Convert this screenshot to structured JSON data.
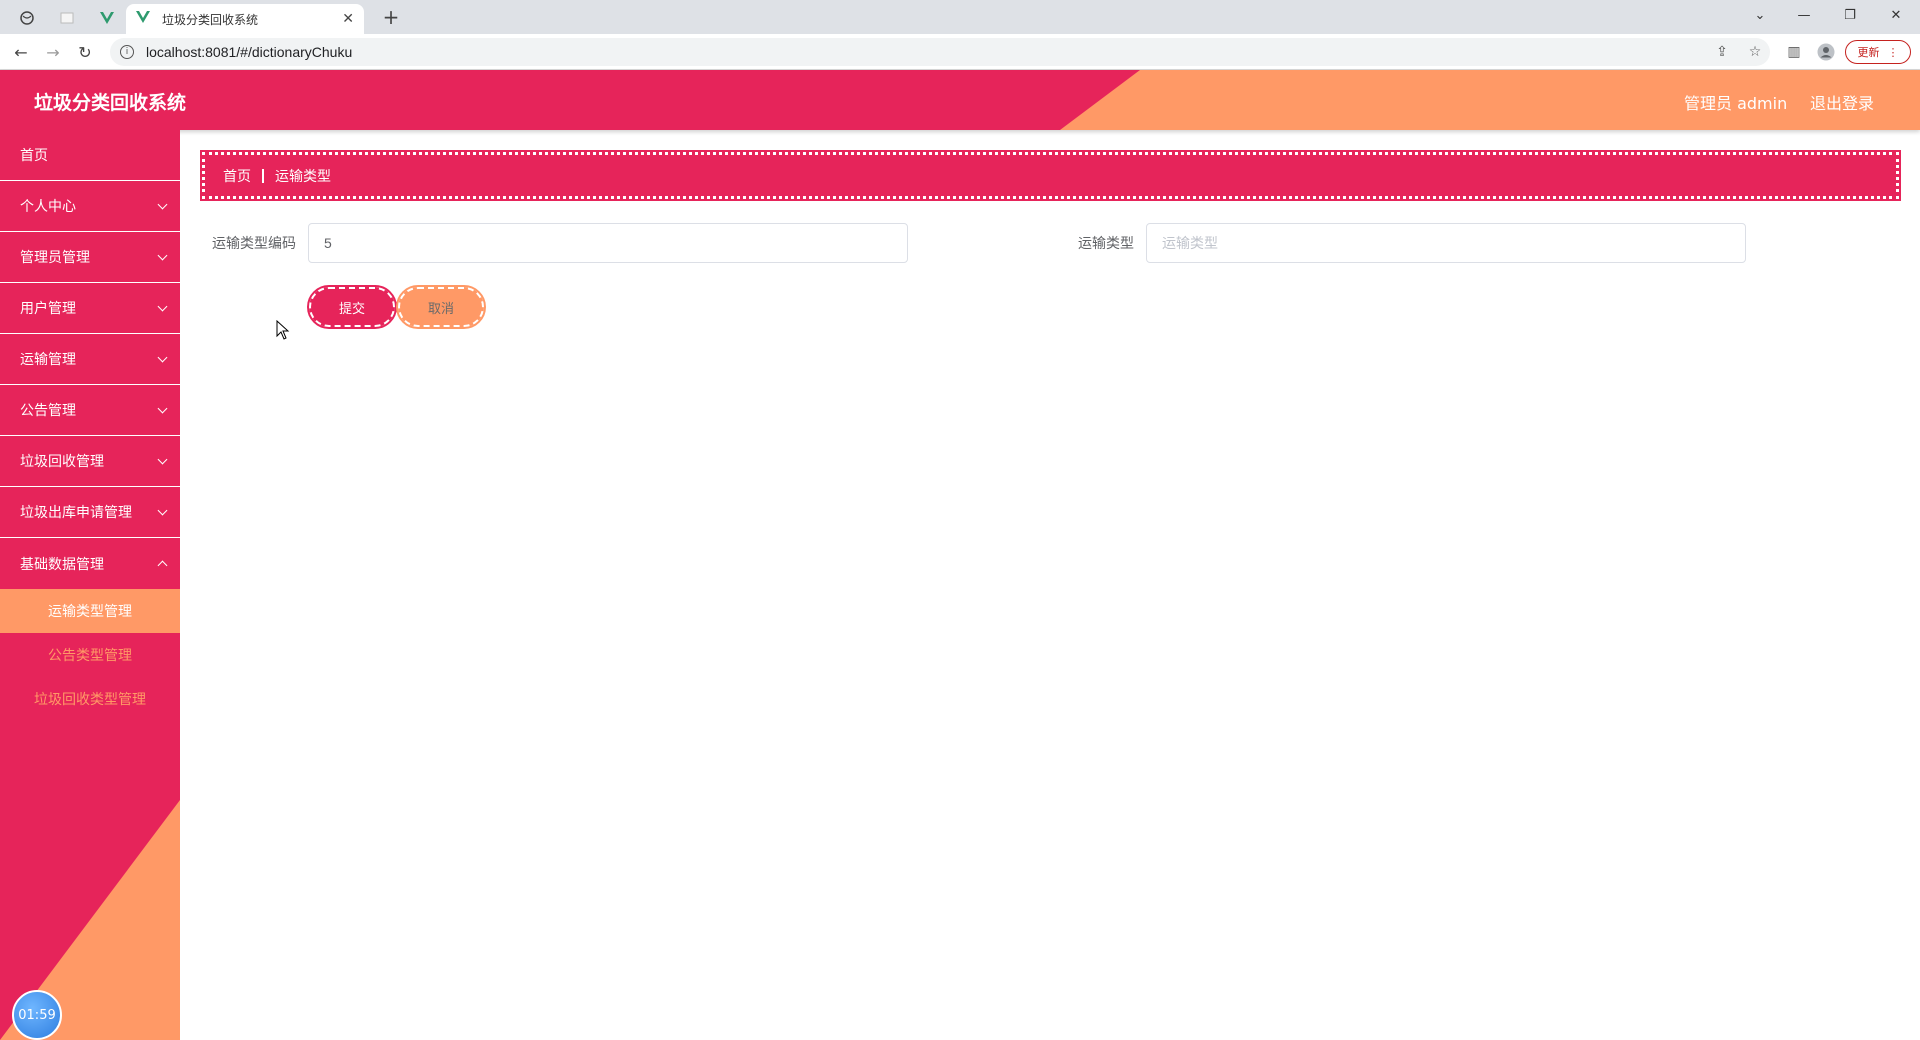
{
  "browser": {
    "tab_title": "垃圾分类回收系统",
    "url": "localhost:8081/#/dictionaryChuku",
    "update_label": "更新"
  },
  "header": {
    "title": "垃圾分类回收系统",
    "user_label": "管理员 admin",
    "logout_label": "退出登录"
  },
  "sidebar": {
    "items": [
      {
        "label": "首页",
        "expandable": false
      },
      {
        "label": "个人中心",
        "expandable": true
      },
      {
        "label": "管理员管理",
        "expandable": true
      },
      {
        "label": "用户管理",
        "expandable": true
      },
      {
        "label": "运输管理",
        "expandable": true
      },
      {
        "label": "公告管理",
        "expandable": true
      },
      {
        "label": "垃圾回收管理",
        "expandable": true
      },
      {
        "label": "垃圾出库申请管理",
        "expandable": true
      },
      {
        "label": "基础数据管理",
        "expandable": true
      }
    ],
    "sub_items": [
      {
        "label": "运输类型管理",
        "active": true
      },
      {
        "label": "公告类型管理",
        "active": false
      },
      {
        "label": "垃圾回收类型管理",
        "active": false
      }
    ],
    "clock": "01:59"
  },
  "breadcrumb": {
    "home": "首页",
    "current": "运输类型"
  },
  "form": {
    "code_label": "运输类型编码",
    "code_value": "5",
    "type_label": "运输类型",
    "type_placeholder": "运输类型",
    "type_value": "",
    "submit_label": "提交",
    "cancel_label": "取消"
  },
  "colors": {
    "primary": "#e6245a",
    "accent": "#ff9966"
  }
}
